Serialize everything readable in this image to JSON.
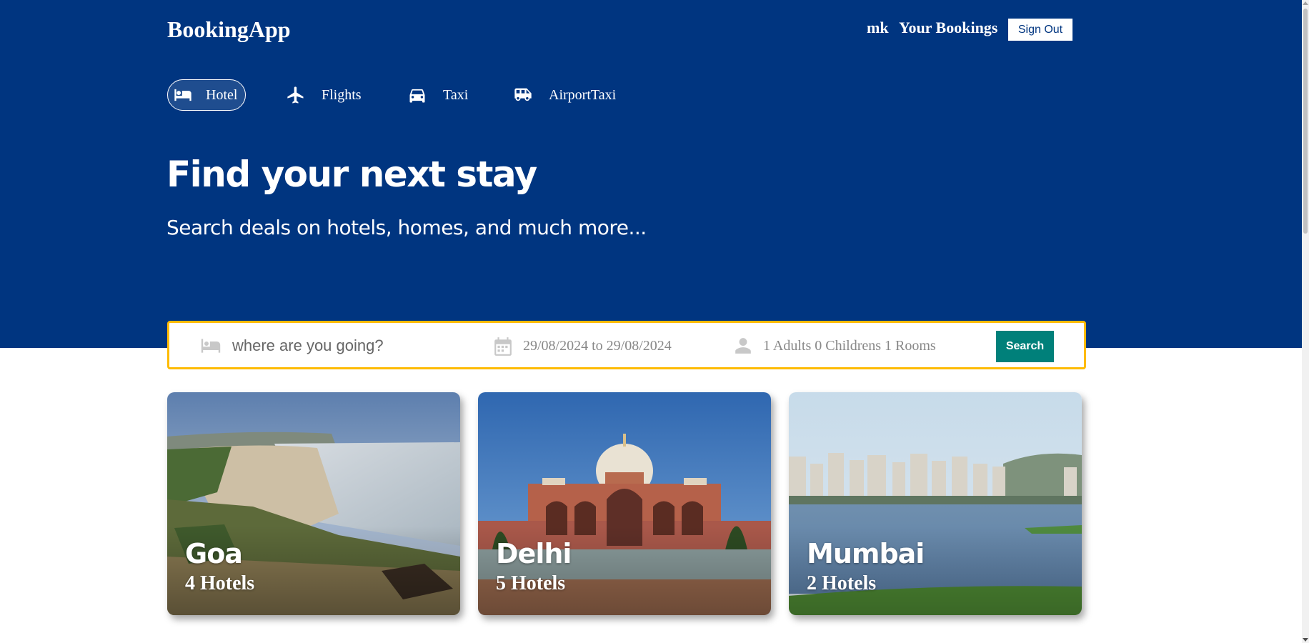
{
  "header": {
    "brand": "BookingApp",
    "user_name": "mk",
    "bookings_link": "Your Bookings",
    "sign_out": "Sign Out"
  },
  "nav": {
    "tabs": [
      {
        "label": "Hotel",
        "icon": "bed-icon",
        "active": true
      },
      {
        "label": "Flights",
        "icon": "plane-icon",
        "active": false
      },
      {
        "label": "Taxi",
        "icon": "car-icon",
        "active": false
      },
      {
        "label": "AirportTaxi",
        "icon": "van-icon",
        "active": false
      }
    ]
  },
  "hero": {
    "title": "Find your next stay",
    "subtitle": "Search deals on hotels, homes, and much more..."
  },
  "search": {
    "destination_placeholder": "where are you going?",
    "destination_value": "",
    "dates": "29/08/2024 to 29/08/2024",
    "occupancy": "1 Adults 0 Childrens 1 Rooms",
    "button": "Search"
  },
  "featured": [
    {
      "city": "Goa",
      "count": "4 Hotels"
    },
    {
      "city": "Delhi",
      "count": "5 Hotels"
    },
    {
      "city": "Mumbai",
      "count": "2 Hotels"
    }
  ],
  "colors": {
    "brand_blue": "#003580",
    "search_border": "#febb02",
    "search_button": "#00807a"
  }
}
